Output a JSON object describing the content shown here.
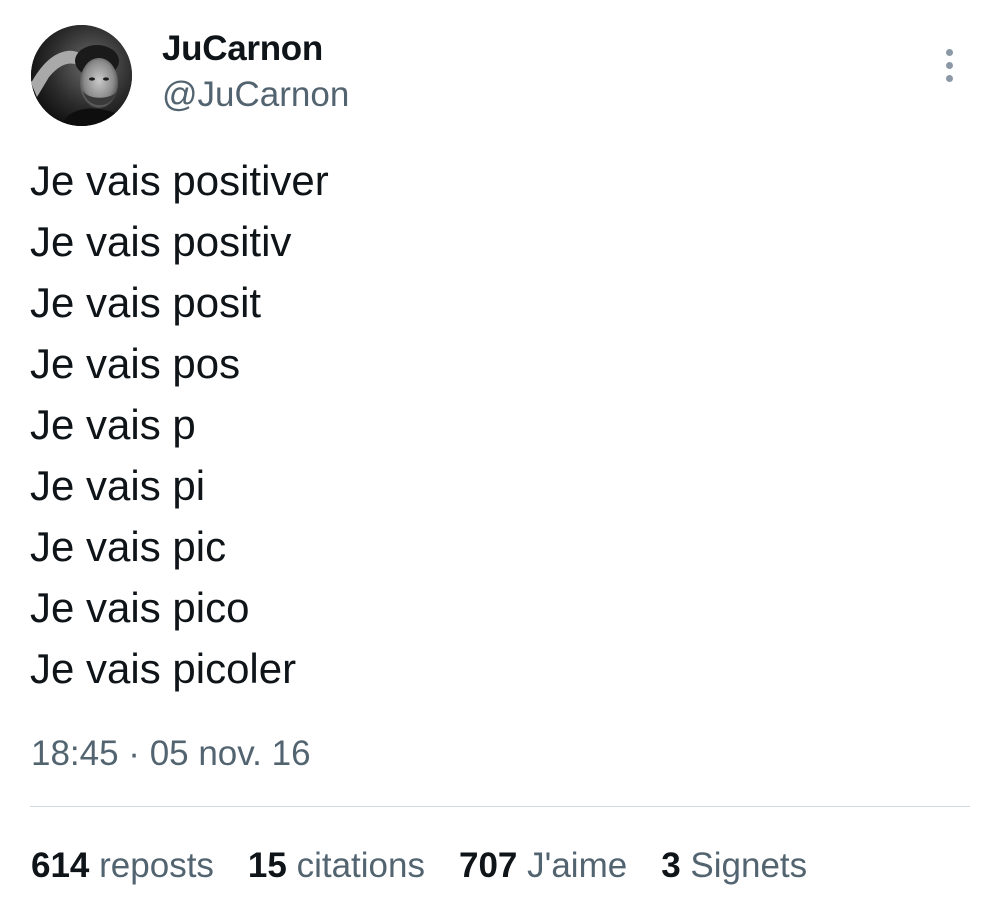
{
  "author": {
    "display_name": "JuCarnon",
    "handle": "@JuCarnon"
  },
  "tweet": {
    "lines": [
      "Je vais positiver",
      "Je vais positiv",
      "Je vais posit",
      "Je vais pos",
      "Je vais p",
      "Je vais pi",
      "Je vais pic",
      "Je vais pico",
      "Je vais picoler"
    ],
    "timestamp": "18:45 · 05 nov. 16"
  },
  "stats": {
    "reposts": {
      "count": "614",
      "label": "reposts"
    },
    "quotes": {
      "count": "15",
      "label": "citations"
    },
    "likes": {
      "count": "707",
      "label": "J'aime"
    },
    "bookmarks": {
      "count": "3",
      "label": "Signets"
    }
  },
  "icons": {
    "more": "more-vertical-icon"
  },
  "colors": {
    "text_primary": "#0f1419",
    "text_secondary": "#536471",
    "divider": "#cfd9de",
    "more_dots": "#8b98a5"
  }
}
